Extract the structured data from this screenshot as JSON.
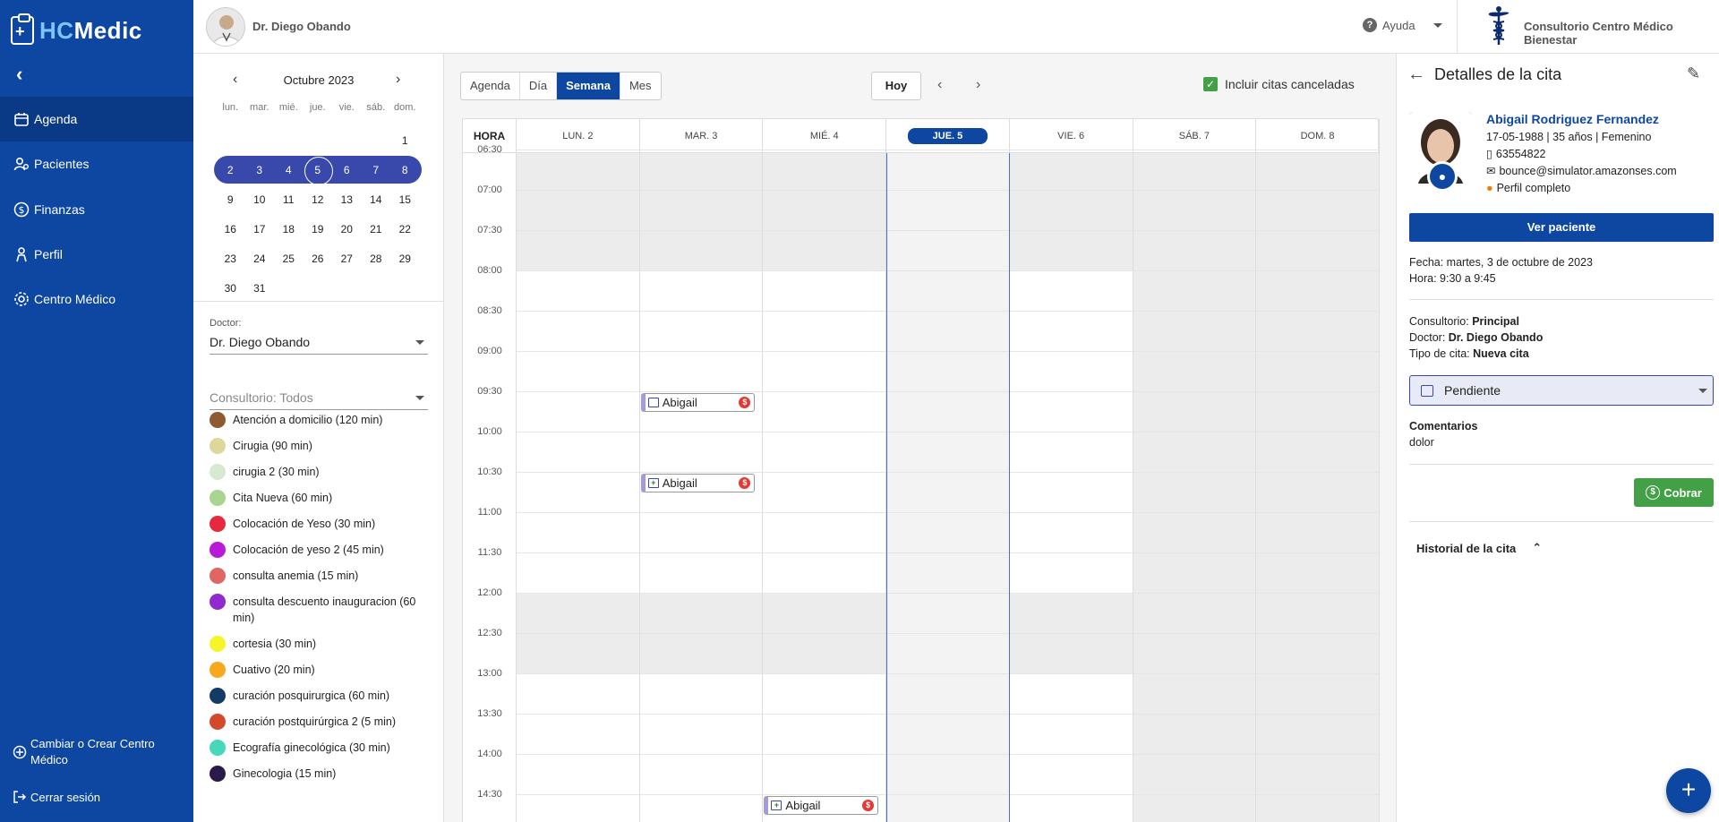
{
  "app": {
    "brand_a": "HC",
    "brand_b": "Medic"
  },
  "sidebar": {
    "collapse": "‹",
    "items": [
      {
        "label": "Agenda",
        "icon": "calendar-icon",
        "active": true
      },
      {
        "label": "Pacientes",
        "icon": "patients-icon"
      },
      {
        "label": "Finanzas",
        "icon": "dollar-icon"
      },
      {
        "label": "Perfil",
        "icon": "profile-icon"
      },
      {
        "label": "Centro Médico",
        "icon": "gear-icon"
      }
    ],
    "bottom": [
      {
        "label": "Cambiar o Crear Centro Médico",
        "icon": "switch-icon"
      },
      {
        "label": "Cerrar sesión",
        "icon": "logout-icon"
      }
    ]
  },
  "topbar": {
    "doctor": "Dr. Diego Obando",
    "help": "Ayuda",
    "clinic": "Consultorio Centro Médico Bienestar"
  },
  "minical": {
    "month": "Octubre 2023",
    "dow": [
      "lun.",
      "mar.",
      "mié.",
      "jue.",
      "vie.",
      "sáb.",
      "dom."
    ],
    "weeks": [
      [
        "",
        "",
        "",
        "",
        "",
        "",
        "1"
      ],
      [
        "2",
        "3",
        "4",
        "5",
        "6",
        "7",
        "8"
      ],
      [
        "9",
        "10",
        "11",
        "12",
        "13",
        "14",
        "15"
      ],
      [
        "16",
        "17",
        "18",
        "19",
        "20",
        "21",
        "22"
      ],
      [
        "23",
        "24",
        "25",
        "26",
        "27",
        "28",
        "29"
      ],
      [
        "30",
        "31",
        "",
        "",
        "",
        "",
        ""
      ]
    ],
    "selected_week_index": 1,
    "today": "5"
  },
  "filters": {
    "doctor_label": "Doctor:",
    "doctor_value": "Dr. Diego Obando",
    "consultorio_value": "Consultorio: Todos"
  },
  "legend": [
    {
      "label": "Atención a domicilio (120 min)",
      "color": "#8d5a32"
    },
    {
      "label": "Cirugia (90 min)",
      "color": "#dcd89a"
    },
    {
      "label": "cirugia 2 (30 min)",
      "color": "#d6ead2"
    },
    {
      "label": "Cita Nueva (60 min)",
      "color": "#a8d590"
    },
    {
      "label": "Colocación de Yeso (30 min)",
      "color": "#e8283c"
    },
    {
      "label": "Colocación de yeso 2 (45 min)",
      "color": "#b81ad8"
    },
    {
      "label": "consulta anemia (15 min)",
      "color": "#e06666"
    },
    {
      "label": "consulta descuento inauguracion (60 min)",
      "color": "#8e2ad0"
    },
    {
      "label": "cortesia (30 min)",
      "color": "#f5f52a"
    },
    {
      "label": "Cuativo (20 min)",
      "color": "#f7a81c"
    },
    {
      "label": "curación posquirurgica (60 min)",
      "color": "#143a66"
    },
    {
      "label": "curación postquirúrgica 2 (5 min)",
      "color": "#d24a2a"
    },
    {
      "label": "Ecografía ginecológica (30 min)",
      "color": "#46d8b8"
    },
    {
      "label": "Ginecologia (15 min)",
      "color": "#2a1a4a"
    }
  ],
  "calendar": {
    "views": [
      {
        "label": "Agenda"
      },
      {
        "label": "Día"
      },
      {
        "label": "Semana",
        "active": true
      },
      {
        "label": "Mes"
      }
    ],
    "today_btn": "Hoy",
    "include_cancelled": "Incluir citas canceladas",
    "hour_header": "HORA",
    "days": [
      "LUN. 2",
      "MAR. 3",
      "MIÉ. 4",
      "JUE. 5",
      "VIE. 6",
      "SÁB. 7",
      "DOM. 8"
    ],
    "today_index": 3,
    "hours": [
      "06:30",
      "07:00",
      "07:30",
      "08:00",
      "08:30",
      "09:00",
      "09:30",
      "10:00",
      "10:30",
      "11:00",
      "11:30",
      "12:00",
      "12:30",
      "13:00",
      "13:30",
      "14:00",
      "14:30"
    ],
    "appointments": [
      {
        "day": 1,
        "start": "9:30",
        "label": "Abigail",
        "kind": "calendar"
      },
      {
        "day": 1,
        "start": "10:30",
        "label": "Abigail",
        "kind": "plus"
      },
      {
        "day": 2,
        "start": "14:30",
        "label": "Abigail",
        "kind": "plus"
      }
    ]
  },
  "details": {
    "title": "Detalles de la cita",
    "patient": {
      "name": "Abigail Rodriguez Fernandez",
      "dob": "17-05-1988 | 35 años | Femenino",
      "phone": "63554822",
      "email": "bounce@simulator.amazonses.com",
      "profile": "Perfil completo"
    },
    "view_patient": "Ver paciente",
    "date": "Fecha: martes, 3 de octubre de 2023",
    "time": "Hora: 9:30 a 9:45",
    "consultorio_label": "Consultorio: ",
    "consultorio": "Principal",
    "doctor_label": "Doctor: ",
    "doctor": "Dr. Diego Obando",
    "tipo_label": "Tipo de cita: ",
    "tipo": "Nueva cita",
    "status": "Pendiente",
    "comments_label": "Comentarios",
    "comments": "dolor",
    "charge": "Cobrar",
    "history": "Historial de la cita"
  },
  "fab": "+"
}
